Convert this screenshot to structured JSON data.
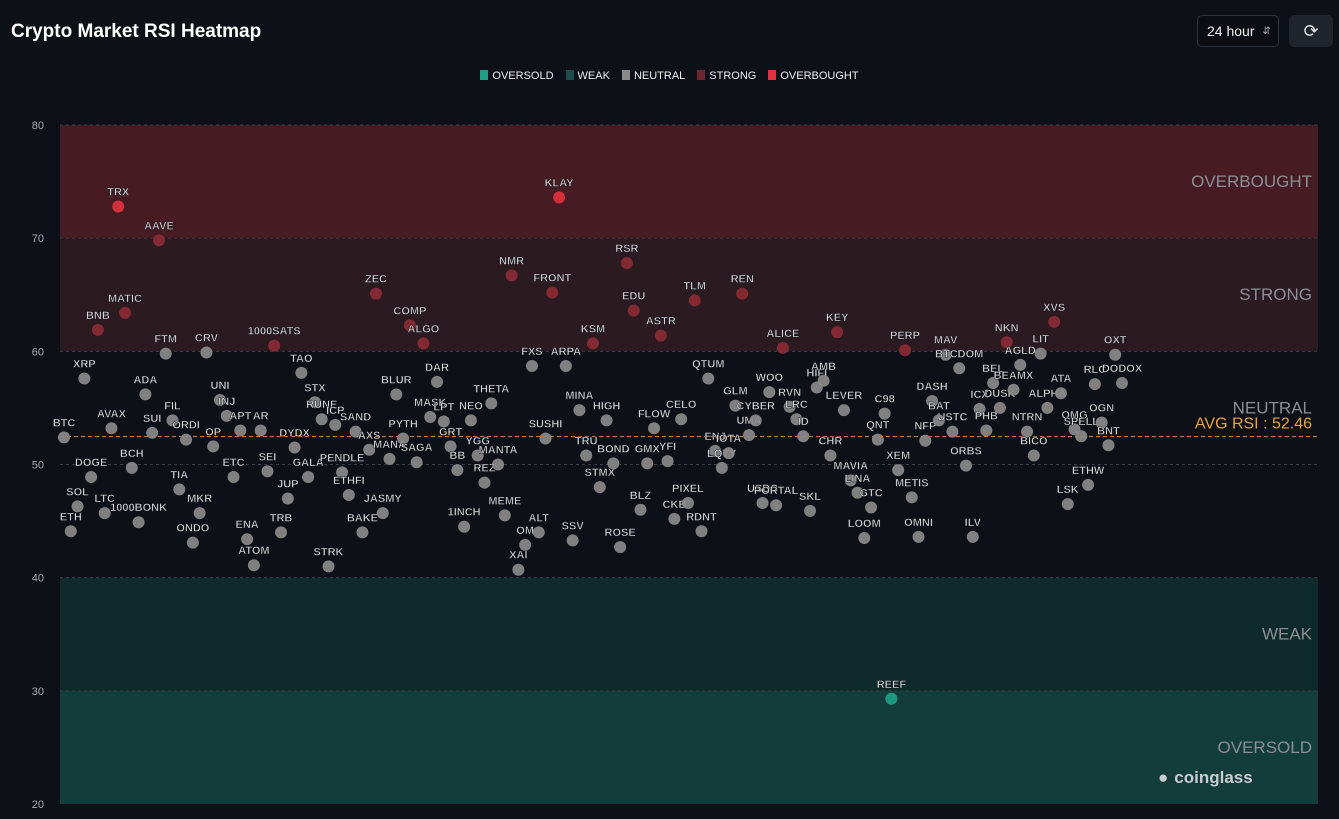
{
  "header": {
    "title": "Crypto Market RSI Heatmap",
    "timeframe": "24 hour",
    "refresh_icon": "refresh-icon"
  },
  "brand": "coinglass",
  "chart_data": {
    "type": "scatter",
    "title": "Crypto Market RSI Heatmap",
    "ylim": [
      20,
      80
    ],
    "yticks": [
      20,
      30,
      40,
      50,
      60,
      70,
      80
    ],
    "grid": true,
    "legend_position": "top",
    "legend": [
      {
        "name": "OVERSOLD",
        "color": "#1f9e87"
      },
      {
        "name": "WEAK",
        "color": "#1d4d4a"
      },
      {
        "name": "NEUTRAL",
        "color": "#8a8a8a"
      },
      {
        "name": "STRONG",
        "color": "#6b2430"
      },
      {
        "name": "OVERBOUGHT",
        "color": "#e0323f"
      }
    ],
    "zones": [
      {
        "label": "OVERBOUGHT",
        "from": 70,
        "to": 80,
        "color": "#461b23"
      },
      {
        "label": "STRONG",
        "from": 60,
        "to": 70,
        "color": "#2b1a20"
      },
      {
        "label": "NEUTRAL",
        "from": 40,
        "to": 60,
        "color": "#0d1016"
      },
      {
        "label": "WEAK",
        "from": 30,
        "to": 40,
        "color": "#0f2a2a"
      },
      {
        "label": "OVERSOLD",
        "from": 20,
        "to": 30,
        "color": "#123d3a"
      }
    ],
    "avg_rsi_label": "AVG RSI : 52.46",
    "avg_rsi": 52.46,
    "points": [
      {
        "symbol": "BTC",
        "rsi": 52.4
      },
      {
        "symbol": "ETH",
        "rsi": 44.1
      },
      {
        "symbol": "SOL",
        "rsi": 46.3
      },
      {
        "symbol": "XRP",
        "rsi": 57.6
      },
      {
        "symbol": "DOGE",
        "rsi": 48.9
      },
      {
        "symbol": "BNB",
        "rsi": 61.9
      },
      {
        "symbol": "LTC",
        "rsi": 45.7
      },
      {
        "symbol": "AVAX",
        "rsi": 53.2
      },
      {
        "symbol": "TRX",
        "rsi": 72.8
      },
      {
        "symbol": "MATIC",
        "rsi": 63.4
      },
      {
        "symbol": "BCH",
        "rsi": 49.7
      },
      {
        "symbol": "1000BONK",
        "rsi": 44.9
      },
      {
        "symbol": "ADA",
        "rsi": 56.2
      },
      {
        "symbol": "SUI",
        "rsi": 52.8
      },
      {
        "symbol": "AAVE",
        "rsi": 69.8
      },
      {
        "symbol": "FTM",
        "rsi": 59.8
      },
      {
        "symbol": "FIL",
        "rsi": 53.9
      },
      {
        "symbol": "TIA",
        "rsi": 47.8
      },
      {
        "symbol": "ORDI",
        "rsi": 52.2
      },
      {
        "symbol": "ONDO",
        "rsi": 43.1
      },
      {
        "symbol": "MKR",
        "rsi": 45.7
      },
      {
        "symbol": "CRV",
        "rsi": 59.9
      },
      {
        "symbol": "OP",
        "rsi": 51.6
      },
      {
        "symbol": "UNI",
        "rsi": 55.7
      },
      {
        "symbol": "INJ",
        "rsi": 54.3
      },
      {
        "symbol": "ETC",
        "rsi": 48.9
      },
      {
        "symbol": "APT",
        "rsi": 53.0
      },
      {
        "symbol": "ENA",
        "rsi": 43.4
      },
      {
        "symbol": "ATOM",
        "rsi": 41.1
      },
      {
        "symbol": "AR",
        "rsi": 53.0
      },
      {
        "symbol": "SEI",
        "rsi": 49.4
      },
      {
        "symbol": "1000SATS",
        "rsi": 60.5
      },
      {
        "symbol": "TRB",
        "rsi": 44.0
      },
      {
        "symbol": "JUP",
        "rsi": 47.0
      },
      {
        "symbol": "DYDX",
        "rsi": 51.5
      },
      {
        "symbol": "TAO",
        "rsi": 58.1
      },
      {
        "symbol": "GALA",
        "rsi": 48.9
      },
      {
        "symbol": "STX",
        "rsi": 55.5
      },
      {
        "symbol": "RUNE",
        "rsi": 54.0
      },
      {
        "symbol": "STRK",
        "rsi": 41.0
      },
      {
        "symbol": "ICP",
        "rsi": 53.5
      },
      {
        "symbol": "PENDLE",
        "rsi": 49.3
      },
      {
        "symbol": "ETHFI",
        "rsi": 47.3
      },
      {
        "symbol": "SAND",
        "rsi": 52.9
      },
      {
        "symbol": "BAKE",
        "rsi": 44.0
      },
      {
        "symbol": "AXS",
        "rsi": 51.3
      },
      {
        "symbol": "ZEC",
        "rsi": 65.1
      },
      {
        "symbol": "JASMY",
        "rsi": 45.7
      },
      {
        "symbol": "MANA",
        "rsi": 50.5
      },
      {
        "symbol": "BLUR",
        "rsi": 56.2
      },
      {
        "symbol": "PYTH",
        "rsi": 52.3
      },
      {
        "symbol": "COMP",
        "rsi": 62.3
      },
      {
        "symbol": "SAGA",
        "rsi": 50.2
      },
      {
        "symbol": "ALGO",
        "rsi": 60.7
      },
      {
        "symbol": "MASK",
        "rsi": 54.2
      },
      {
        "symbol": "DAR",
        "rsi": 57.3
      },
      {
        "symbol": "LPT",
        "rsi": 53.8
      },
      {
        "symbol": "GRT",
        "rsi": 51.6
      },
      {
        "symbol": "BB",
        "rsi": 49.5
      },
      {
        "symbol": "1INCH",
        "rsi": 44.5
      },
      {
        "symbol": "NEO",
        "rsi": 53.9
      },
      {
        "symbol": "YGG",
        "rsi": 50.8
      },
      {
        "symbol": "REZ",
        "rsi": 48.4
      },
      {
        "symbol": "THETA",
        "rsi": 55.4
      },
      {
        "symbol": "MANTA",
        "rsi": 50.0
      },
      {
        "symbol": "MEME",
        "rsi": 45.5
      },
      {
        "symbol": "NMR",
        "rsi": 66.7
      },
      {
        "symbol": "XAI",
        "rsi": 40.7
      },
      {
        "symbol": "OM",
        "rsi": 42.9
      },
      {
        "symbol": "FXS",
        "rsi": 58.7
      },
      {
        "symbol": "ALT",
        "rsi": 44.0
      },
      {
        "symbol": "SUSHI",
        "rsi": 52.3
      },
      {
        "symbol": "FRONT",
        "rsi": 65.2
      },
      {
        "symbol": "KLAY",
        "rsi": 73.6
      },
      {
        "symbol": "ARPA",
        "rsi": 58.7
      },
      {
        "symbol": "SSV",
        "rsi": 43.3
      },
      {
        "symbol": "MINA",
        "rsi": 54.8
      },
      {
        "symbol": "TRU",
        "rsi": 50.8
      },
      {
        "symbol": "KSM",
        "rsi": 60.7
      },
      {
        "symbol": "STMX",
        "rsi": 48.0
      },
      {
        "symbol": "HIGH",
        "rsi": 53.9
      },
      {
        "symbol": "BOND",
        "rsi": 50.1
      },
      {
        "symbol": "ROSE",
        "rsi": 42.7
      },
      {
        "symbol": "RSR",
        "rsi": 67.8
      },
      {
        "symbol": "EDU",
        "rsi": 63.6
      },
      {
        "symbol": "BLZ",
        "rsi": 46.0
      },
      {
        "symbol": "GMX",
        "rsi": 50.1
      },
      {
        "symbol": "FLOW",
        "rsi": 53.2
      },
      {
        "symbol": "ASTR",
        "rsi": 61.4
      },
      {
        "symbol": "YFI",
        "rsi": 50.3
      },
      {
        "symbol": "CKB",
        "rsi": 45.2
      },
      {
        "symbol": "CELO",
        "rsi": 54.0
      },
      {
        "symbol": "PIXEL",
        "rsi": 46.6
      },
      {
        "symbol": "TLM",
        "rsi": 64.5
      },
      {
        "symbol": "RDNT",
        "rsi": 44.1
      },
      {
        "symbol": "QTUM",
        "rsi": 57.6
      },
      {
        "symbol": "ENJ",
        "rsi": 51.2
      },
      {
        "symbol": "LQTY",
        "rsi": 49.7
      },
      {
        "symbol": "IOTA",
        "rsi": 51.0
      },
      {
        "symbol": "GLM",
        "rsi": 55.2
      },
      {
        "symbol": "REN",
        "rsi": 65.1
      },
      {
        "symbol": "UMA",
        "rsi": 52.6
      },
      {
        "symbol": "CYBER",
        "rsi": 53.9
      },
      {
        "symbol": "USDC",
        "rsi": 46.6
      },
      {
        "symbol": "WOO",
        "rsi": 56.4
      },
      {
        "symbol": "PORTAL",
        "rsi": 46.4
      },
      {
        "symbol": "ALICE",
        "rsi": 60.3
      },
      {
        "symbol": "RVN",
        "rsi": 55.1
      },
      {
        "symbol": "LRC",
        "rsi": 54.0
      },
      {
        "symbol": "ID",
        "rsi": 52.5
      },
      {
        "symbol": "SKL",
        "rsi": 45.9
      },
      {
        "symbol": "HIFI",
        "rsi": 56.8
      },
      {
        "symbol": "AMB",
        "rsi": 57.4
      },
      {
        "symbol": "CHR",
        "rsi": 50.8
      },
      {
        "symbol": "KEY",
        "rsi": 61.7
      },
      {
        "symbol": "LEVER",
        "rsi": 54.8
      },
      {
        "symbol": "MAVIA",
        "rsi": 48.6
      },
      {
        "symbol": "LINA",
        "rsi": 47.5
      },
      {
        "symbol": "LOOM",
        "rsi": 43.5
      },
      {
        "symbol": "GTC",
        "rsi": 46.2
      },
      {
        "symbol": "QNT",
        "rsi": 52.2
      },
      {
        "symbol": "C98",
        "rsi": 54.5
      },
      {
        "symbol": "REEF",
        "rsi": 29.3
      },
      {
        "symbol": "XEM",
        "rsi": 49.5
      },
      {
        "symbol": "PERP",
        "rsi": 60.1
      },
      {
        "symbol": "METIS",
        "rsi": 47.1
      },
      {
        "symbol": "OMNI",
        "rsi": 43.6
      },
      {
        "symbol": "NFP",
        "rsi": 52.1
      },
      {
        "symbol": "DASH",
        "rsi": 55.6
      },
      {
        "symbol": "BAT",
        "rsi": 53.9
      },
      {
        "symbol": "MAV",
        "rsi": 59.7
      },
      {
        "symbol": "USTC",
        "rsi": 52.9
      },
      {
        "symbol": "BTCDOM",
        "rsi": 58.5
      },
      {
        "symbol": "ORBS",
        "rsi": 49.9
      },
      {
        "symbol": "ILV",
        "rsi": 43.6
      },
      {
        "symbol": "ICX",
        "rsi": 54.9
      },
      {
        "symbol": "PHB",
        "rsi": 53.0
      },
      {
        "symbol": "BEL",
        "rsi": 57.2
      },
      {
        "symbol": "DUSK",
        "rsi": 55.0
      },
      {
        "symbol": "NKN",
        "rsi": 60.8
      },
      {
        "symbol": "BEAMX",
        "rsi": 56.6
      },
      {
        "symbol": "AGLD",
        "rsi": 58.8
      },
      {
        "symbol": "NTRN",
        "rsi": 52.9
      },
      {
        "symbol": "BICO",
        "rsi": 50.8
      },
      {
        "symbol": "LIT",
        "rsi": 59.8
      },
      {
        "symbol": "ALPHA",
        "rsi": 55.0
      },
      {
        "symbol": "XVS",
        "rsi": 62.6
      },
      {
        "symbol": "ATA",
        "rsi": 56.3
      },
      {
        "symbol": "LSK",
        "rsi": 46.5
      },
      {
        "symbol": "OMG",
        "rsi": 53.1
      },
      {
        "symbol": "SPELL",
        "rsi": 52.5
      },
      {
        "symbol": "ETHW",
        "rsi": 48.2
      },
      {
        "symbol": "RLC",
        "rsi": 57.1
      },
      {
        "symbol": "OGN",
        "rsi": 53.7
      },
      {
        "symbol": "BNT",
        "rsi": 51.7
      },
      {
        "symbol": "OXT",
        "rsi": 59.7
      },
      {
        "symbol": "DODOX",
        "rsi": 57.2
      }
    ]
  }
}
